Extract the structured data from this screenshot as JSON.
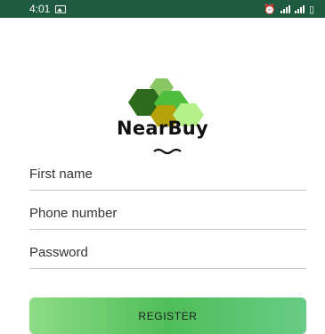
{
  "status_bar": {
    "time": "4:01",
    "icons": [
      "image-icon",
      "alarm-icon",
      "signal-icon",
      "signal-icon",
      "battery-icon"
    ],
    "background": "#1d5a3f"
  },
  "brand": {
    "name": "NearBuy",
    "logo_colors": [
      "#2e6b1f",
      "#89c765",
      "#4fbe3e",
      "#b5a20b",
      "#b6f08a"
    ]
  },
  "form": {
    "first_name_placeholder": "First name",
    "phone_placeholder": "Phone number",
    "password_placeholder": "Password",
    "register_label": "REGISTER"
  },
  "colors": {
    "accent": "#4fbe59"
  }
}
